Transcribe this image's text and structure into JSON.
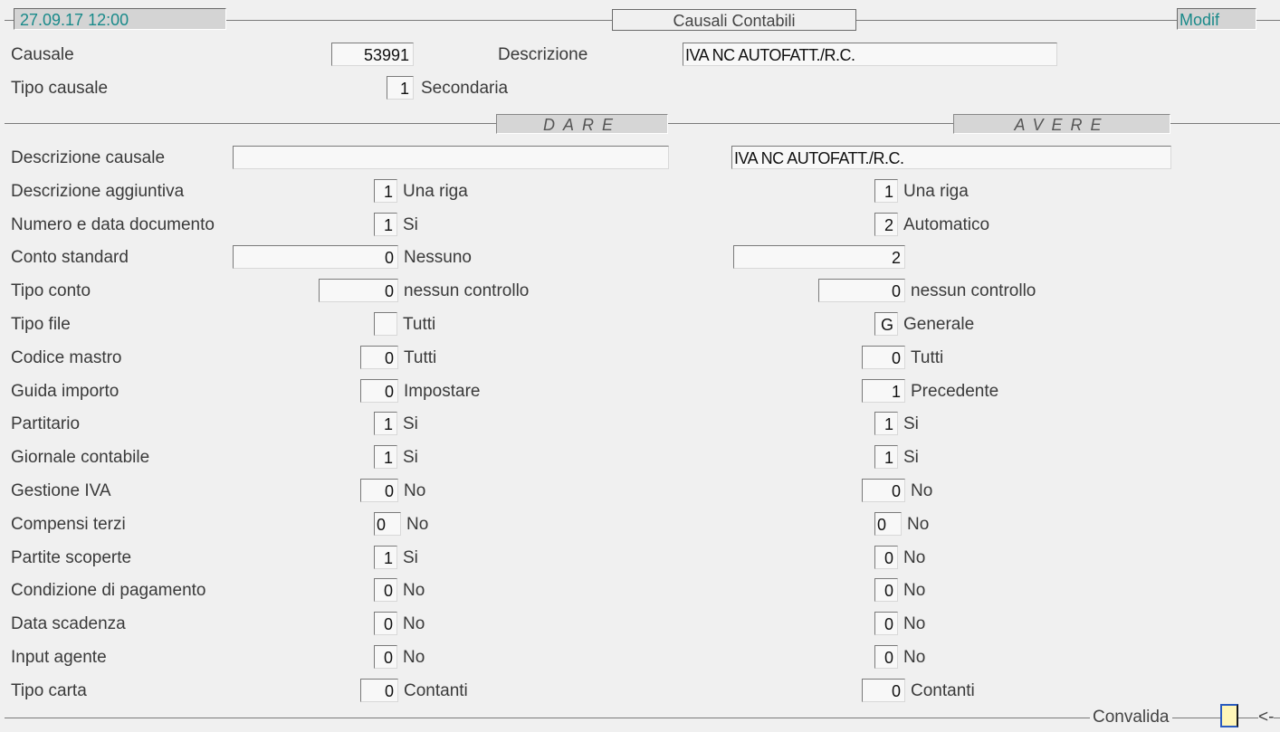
{
  "top": {
    "timestamp": "27.09.17 12:00",
    "title": "Causali Contabili",
    "mode": "Modif"
  },
  "causale": {
    "label": "Causale",
    "value": "53991"
  },
  "descrizione": {
    "label": "Descrizione",
    "value": "IVA NC AUTOFATT./R.C."
  },
  "tipo_causale": {
    "label": "Tipo causale",
    "code": "1",
    "desc": "Secondaria"
  },
  "headers": {
    "dare": "DARE",
    "avere": "AVERE"
  },
  "rows": [
    {
      "label": "Descrizione causale",
      "dare_value": "",
      "avere_value": "IVA NC AUTOFATT./R.C."
    },
    {
      "label": "Descrizione aggiuntiva",
      "dare_code": "1",
      "dare_desc": "Una riga",
      "avere_code": "1",
      "avere_desc": "Una riga"
    },
    {
      "label": "Numero e data documento",
      "dare_code": "1",
      "dare_desc": "Si",
      "avere_code": "2",
      "avere_desc": "Automatico"
    },
    {
      "label": "Conto standard",
      "dare_code": "0",
      "dare_desc": "Nessuno",
      "avere_code": "2",
      "avere_desc": ""
    },
    {
      "label": "Tipo conto",
      "dare_code": "0",
      "dare_desc": "nessun controllo",
      "avere_code": "0",
      "avere_desc": "nessun controllo"
    },
    {
      "label": "Tipo file",
      "dare_code": "",
      "dare_desc": "Tutti",
      "avere_code": "G",
      "avere_desc": "Generale"
    },
    {
      "label": "Codice mastro",
      "dare_code": "0",
      "dare_desc": "Tutti",
      "avere_code": "0",
      "avere_desc": "Tutti"
    },
    {
      "label": "Guida importo",
      "dare_code": "0",
      "dare_desc": "Impostare",
      "avere_code": "1",
      "avere_desc": "Precedente"
    },
    {
      "label": "Partitario",
      "dare_code": "1",
      "dare_desc": "Si",
      "avere_code": "1",
      "avere_desc": "Si"
    },
    {
      "label": "Giornale contabile",
      "dare_code": "1",
      "dare_desc": "Si",
      "avere_code": "1",
      "avere_desc": "Si"
    },
    {
      "label": "Gestione IVA",
      "dare_code": "0",
      "dare_desc": "No",
      "avere_code": "0",
      "avere_desc": "No"
    },
    {
      "label": "Compensi terzi",
      "dare_code": "0",
      "dare_desc": "No",
      "avere_code": "0",
      "avere_desc": "No"
    },
    {
      "label": "Partite scoperte",
      "dare_code": "1",
      "dare_desc": "Si",
      "avere_code": "0",
      "avere_desc": "No"
    },
    {
      "label": "Condizione di pagamento",
      "dare_code": "0",
      "dare_desc": "No",
      "avere_code": "0",
      "avere_desc": "No"
    },
    {
      "label": "Data scadenza",
      "dare_code": "0",
      "dare_desc": "No",
      "avere_code": "0",
      "avere_desc": "No"
    },
    {
      "label": "Input agente",
      "dare_code": "0",
      "dare_desc": "No",
      "avere_code": "0",
      "avere_desc": "No"
    },
    {
      "label": "Tipo carta",
      "dare_code": "0",
      "dare_desc": "Contanti",
      "avere_code": "0",
      "avere_desc": "Contanti"
    }
  ],
  "footer": {
    "convalida": "Convalida",
    "arrow": "<-"
  }
}
